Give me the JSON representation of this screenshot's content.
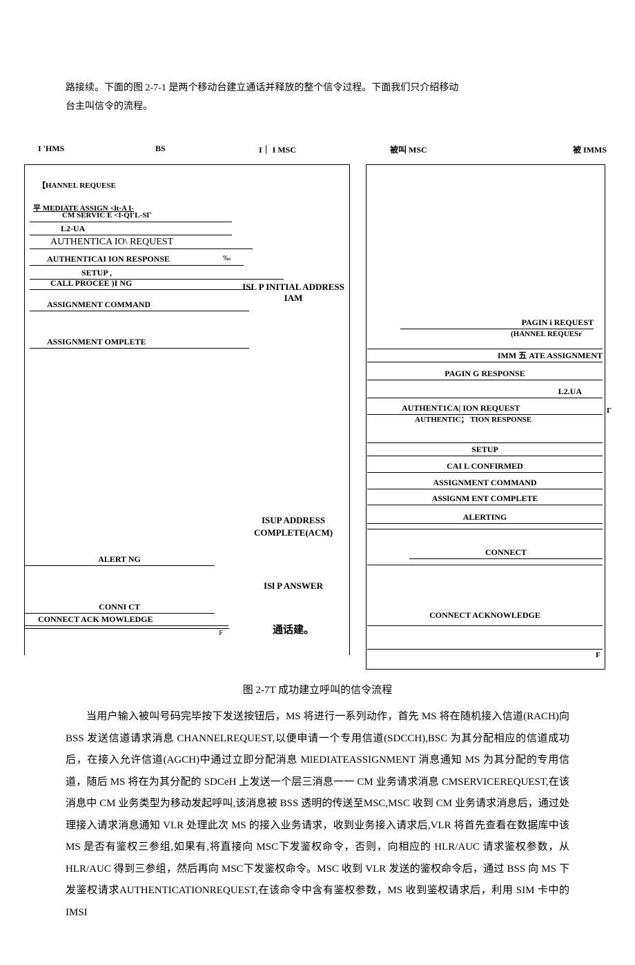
{
  "intro": {
    "line1": "路接续。下面的图 2-7-1 是两个移动台建立通话并释放的整个信令过程。下面我们只介绍移动",
    "line2": "台主叫信令的流程。"
  },
  "headers": {
    "h1": "I 'HMS",
    "h2": "BS",
    "h3": "I｜ I MSC",
    "h4": "被叫 MSC",
    "h5": "被 IMMS"
  },
  "left_msgs": {
    "m0": "【HANNEL REQUESE",
    "m1": "平 MEDIATE ASSIGN <lt·A I-",
    "m1b": "CM SERVIC E <I-QI'L-SГ",
    "m2": "L2-UA",
    "m3": "AUTHENTICA IO\\ REQUEST",
    "m4": "AUTHENTICAI ION RESPONSE",
    "m4s": "‰",
    "m5": "SETUP ,",
    "m6": "CALL PROCEE )I NG",
    "m7": "ASSIGNMENT COMMAND",
    "m8": "ASSIGNMENT OMPLETE",
    "m9": "ALERT NG",
    "m10": "CONNI CT",
    "m11": "CONNECT ACK MOWLEDGE",
    "fL": "F"
  },
  "center_msgs": {
    "c1": "ISL P INITIAL ADDRESS IAM",
    "c2a": "ISUP ADDRESS",
    "c2b": "COMPLETE(ACM)",
    "c3": "ISl P ANSWER",
    "c4": "通话建。"
  },
  "right_msgs": {
    "r1": "PAGIN i REQUEST",
    "r2": "(HANNEL REQUESr",
    "r3": "IMM 五 ATE ASSIGNMENT",
    "r4": "PAGIN G RESPONSE",
    "r5": "L2.UA",
    "r6": "AUTHENT1CA| ION REQUEST",
    "r7": "AUTHENTIC； TION RESPONSE",
    "r7s": "Г",
    "r8": "SETUP",
    "r9": "CAI L CONFIRMED",
    "r10": "ASSIGNMENT COMMAND",
    "r11": "ASSlGNM ENT COMPLETE",
    "r12": "ALERTING",
    "r13": "CONNECT",
    "r14": "CONNECT ACKNOWLEDGE",
    "fr": "F"
  },
  "caption": "图 2-7T 成功建立呼叫的信令流程",
  "paragraph": "当用户输入被叫号码完毕按下发送按钮后，MS 将进行一系列动作，首先 MS 将在随机接入信道(RACH)向 BSS 发送信道请求消息 CHANNELREQUEST,以便申请一个专用信道(SDCCH),BSC 为其分配相应的信道成功后，在接入允许信道(AGCH)中通过立即分配消息 MlEDIATEASSIGNMENT 消息通知 MS 为其分配的专用信道，随后 MS 将在为其分配的 SDCeH 上发送一个层三消息一一 CM 业务请求消息 CMSERVICEREQUEST,在该消息中 CM 业务类型为移动发起呼叫,该消息被 BSS 透明的传送至MSC,MSC 收到 CM 业务请求消息后，通过处理接入请求消息通知 VLR 处理此次 MS 的接入业务请求，收到业务接入请求后,VLR 将首先查看在数据库中该 MS 是否有鉴权三参组,如果有,将直接向 MSC下发鉴权命令，否则，向相应的 HLR/AUC 请求鉴权参数，从 HLR/AUC 得到三参组，然后再向 MSC下发鉴权命令。MSC 收到 VLR 发送的鉴权命令后，通过 BSS 向 MS 下发鉴权请求AUTHENTICATIONREQUEST,在该命令中含有鉴权参数，MS 收到鉴权请求后，利用 SIM 卡中的 IMSI"
}
